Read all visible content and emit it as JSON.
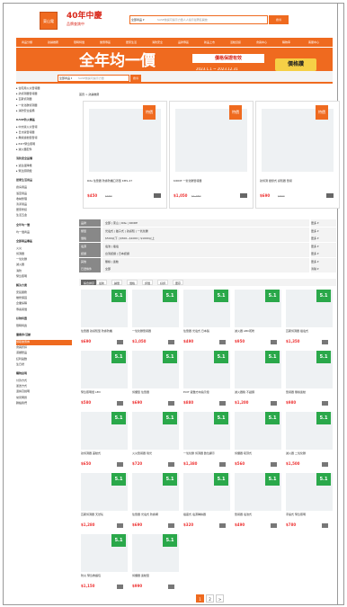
{
  "header": {
    "logo_text": "東山電",
    "brand_title": "40年中慶",
    "brand_sub": "品牌查詢中",
    "search_category": "全部商品 ▾",
    "search_placeholder": "SASE前提可提示力量人人指示最著名開放",
    "search_button": "搜尋"
  },
  "nav": {
    "items": [
      "商品分類",
      "熱銷推薦",
      "限時特價",
      "優惠專區",
      "居家生活",
      "消防安全",
      "品牌專區",
      "新品上市",
      "活動資訊",
      "會員中心",
      "購物車",
      "客服中心"
    ]
  },
  "banner": {
    "title": "全年均一價",
    "sub": "價格保證有效",
    "date": "2023.1.1 ~ 2023.12.31",
    "badge": "價格讚",
    "search_category": "全部商品 ▾",
    "search_placeholder": "SASE前提可提示力量",
    "search_button": "搜尋"
  },
  "breadcrumb": "首頁 > 熱銷推薦",
  "sidebar": [
    {
      "label": "▸ 住宅用火災警報器",
      "type": "item"
    },
    {
      "label": "▸ 熱偵測器警報器",
      "type": "item"
    },
    {
      "label": "▸ 瓦斯偵測器",
      "type": "item"
    },
    {
      "label": "▸ 一氧化碳偵測器",
      "type": "item"
    },
    {
      "label": "▸ 消防安全設備",
      "type": "item"
    },
    {
      "label": "KASE防火專區",
      "type": "head"
    },
    {
      "label": "▸ 中文版火災警報",
      "type": "item"
    },
    {
      "label": "▸ 日文版警報器",
      "type": "item"
    },
    {
      "label": "▸ 無線連動型警報",
      "type": "item"
    },
    {
      "label": "▸ EXIT緊急照明",
      "type": "item"
    },
    {
      "label": "▸ 滅火器配件",
      "type": "item"
    },
    {
      "label": "消防安全設備",
      "type": "head"
    },
    {
      "label": "▸ 逃生緩降機",
      "type": "item"
    },
    {
      "label": "▸ 緊急照明燈",
      "type": "item"
    },
    {
      "label": "居家生活用品",
      "type": "head"
    },
    {
      "label": "廚房用品",
      "type": "item"
    },
    {
      "label": "浴室用品",
      "type": "item"
    },
    {
      "label": "收納整理",
      "type": "item"
    },
    {
      "label": "清潔用品",
      "type": "item"
    },
    {
      "label": "居家修繕",
      "type": "item"
    },
    {
      "label": "生活五金",
      "type": "item"
    },
    {
      "label": "全年均一價",
      "type": "head"
    },
    {
      "label": "均一價商品",
      "type": "item"
    },
    {
      "label": "全部商品專區",
      "type": "head"
    },
    {
      "label": "火災",
      "type": "item"
    },
    {
      "label": "偵測器",
      "type": "item"
    },
    {
      "label": "一氧化碳",
      "type": "item"
    },
    {
      "label": "滅火器",
      "type": "item"
    },
    {
      "label": "消防",
      "type": "item"
    },
    {
      "label": "緊急照明",
      "type": "item"
    },
    {
      "label": "解決方案",
      "type": "head"
    },
    {
      "label": "安裝服務",
      "type": "item"
    },
    {
      "label": "維修保固",
      "type": "item"
    },
    {
      "label": "企業採購",
      "type": "item"
    },
    {
      "label": "專案報價",
      "type": "item"
    },
    {
      "label": "好物特賣",
      "type": "head"
    },
    {
      "label": "限時特賣",
      "type": "item"
    },
    {
      "label": "優惠券/活動",
      "type": "head"
    },
    {
      "label": "領取優惠券",
      "type": "item",
      "selected": true
    },
    {
      "label": "會員折扣",
      "type": "item"
    },
    {
      "label": "滿額贈品",
      "type": "item"
    },
    {
      "label": "紅利點數",
      "type": "item"
    },
    {
      "label": "生日禮",
      "type": "item"
    },
    {
      "label": "購物說明",
      "type": "head"
    },
    {
      "label": "付款方式",
      "type": "item"
    },
    {
      "label": "運送方式",
      "type": "item"
    },
    {
      "label": "退換貨說明",
      "type": "item"
    },
    {
      "label": "常見問題",
      "type": "item"
    },
    {
      "label": "聯絡我們",
      "type": "item"
    }
  ],
  "featured": [
    {
      "name": "Rite 住警器 防塵防蟲口罩型 KMS-47",
      "price": "$450",
      "old": "$680",
      "tag": "特價"
    },
    {
      "name": "KIDDE 一氧化碳警報器",
      "price": "$1,050",
      "old": "$1,380",
      "tag": "特價"
    },
    {
      "name": "熱偵測 壁掛式 感知器 警報",
      "price": "$690",
      "old": "$890",
      "tag": "特價"
    }
  ],
  "filters": [
    {
      "label": "品牌",
      "value": "全部 | 東山 | Rite | KIDDE",
      "more": "更多 ▾"
    },
    {
      "label": "類型",
      "value": "光電式 | 離子式 | 熱感知 | 一氧化碳",
      "more": "更多 ▾"
    },
    {
      "label": "價格",
      "value": "$500以下 | $500~$1000 | $1000以上",
      "more": "更多 ▾"
    },
    {
      "label": "電源",
      "value": "電池 | 插電",
      "more": "更多 ▾"
    },
    {
      "label": "認證",
      "value": "台灣認證 | 日本認證",
      "more": "更多 ▾"
    },
    {
      "label": "其他",
      "value": "無線 | 連動",
      "more": "更多 ▾"
    },
    {
      "label": "已選條件",
      "value": "全部",
      "more": "清除 ▾"
    }
  ],
  "sort": [
    "綜合排序",
    "最新",
    "銷量",
    "價格",
    "評價",
    "好評",
    "庫存"
  ],
  "products": [
    {
      "name": "住警器 熱感知型 防塵防蟲",
      "price": "$690",
      "badge": "5.1"
    },
    {
      "name": "一氧化碳警報器",
      "price": "$1,050",
      "badge": "5.1"
    },
    {
      "name": "住警器 光電式 日本製",
      "price": "$490",
      "badge": "5.1"
    },
    {
      "name": "滅火器 ABC乾粉",
      "price": "$950",
      "badge": "5.1"
    },
    {
      "name": "瓦斯偵測器 插電式",
      "price": "$1,350",
      "badge": "5.1"
    },
    {
      "name": "緊急照明燈 LED",
      "price": "$580",
      "badge": "5.1"
    },
    {
      "name": "偵煙型 住警器",
      "price": "$690",
      "badge": "5.1"
    },
    {
      "name": "EXIT 避難方向指示燈",
      "price": "$880",
      "badge": "5.1"
    },
    {
      "name": "滅火器箱 不鏽鋼",
      "price": "$1,200",
      "badge": "5.1"
    },
    {
      "name": "警報器 無線連動",
      "price": "$980",
      "badge": "5.1"
    },
    {
      "name": "熱偵測器 差動式",
      "price": "$650",
      "badge": "5.1"
    },
    {
      "name": "火災警報器 聲光",
      "price": "$720",
      "badge": "5.1"
    },
    {
      "name": "一氧化碳 偵測器 數位顯示",
      "price": "$1,380",
      "badge": "5.1"
    },
    {
      "name": "偵煙器 吸頂式",
      "price": "$560",
      "badge": "5.1"
    },
    {
      "name": "滅火器 二氧化碳",
      "price": "$1,500",
      "badge": "5.1"
    },
    {
      "name": "瓦斯偵測器 天然氣",
      "price": "$1,280",
      "badge": "5.1"
    },
    {
      "name": "住警器 光電式 防塵網",
      "price": "$690",
      "badge": "5.1"
    },
    {
      "name": "插座式 電源轉換器",
      "price": "$320",
      "badge": "5.1"
    },
    {
      "name": "警報器 電池式",
      "price": "$490",
      "badge": "5.1"
    },
    {
      "name": "手提式 緊急照明",
      "price": "$780",
      "badge": "5.1"
    },
    {
      "name": "防災 緊急救護包",
      "price": "$1,150",
      "badge": "5.1"
    },
    {
      "name": "偵煙器 連動型",
      "price": "$990",
      "badge": "5.1"
    }
  ],
  "pager": {
    "pages": [
      "1",
      "2",
      ">"
    ],
    "current": "1"
  }
}
